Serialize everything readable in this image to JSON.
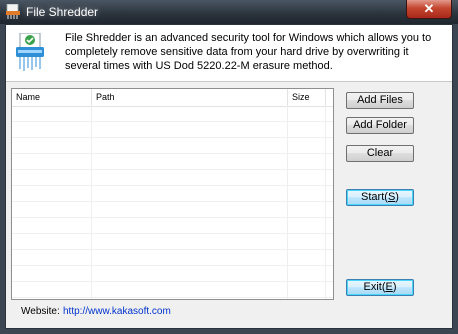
{
  "window": {
    "title": "File Shredder",
    "close_glyph": "✕",
    "app_icon": "shredder-app-icon"
  },
  "header": {
    "icon": "shredder-icon",
    "description": "File Shredder is an advanced security tool for Windows which allows you to completely remove sensitive data from your hard drive by overwriting it several times with US Dod 5220.22-M erasure method."
  },
  "file_list": {
    "columns": [
      "Name",
      "Path",
      "Size"
    ],
    "rows": []
  },
  "buttons": {
    "add_files": "Add Files",
    "add_folder": "Add Folder",
    "clear": "Clear",
    "start_main": "Start(",
    "start_key": "S",
    "start_end": ")",
    "exit_main": "Exit(",
    "exit_key": "E",
    "exit_end": ")"
  },
  "footer": {
    "website_label": "Website:",
    "website_url": "http://www.kakasoft.com"
  },
  "colors": {
    "titlebar": "#2a333c",
    "close_button": "#c4462f",
    "link": "#0033cc"
  }
}
